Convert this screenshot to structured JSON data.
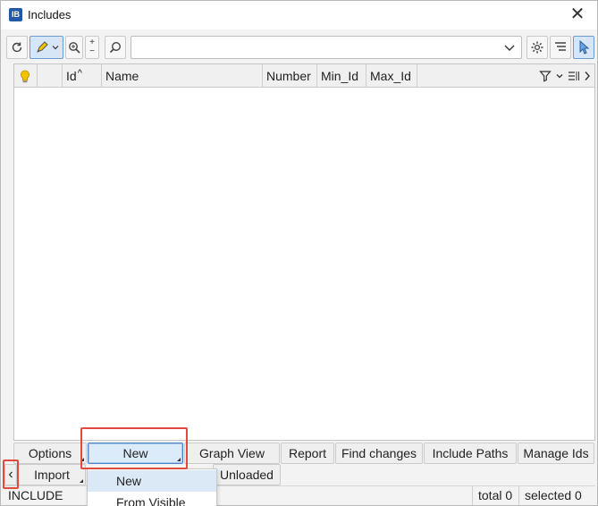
{
  "window": {
    "title": "Includes",
    "app_icon_text": "IB"
  },
  "toolbar": {
    "search_value": "",
    "zoom_plus": "+",
    "zoom_minus": "−"
  },
  "grid": {
    "columns": [
      {
        "label": ""
      },
      {
        "label": ""
      },
      {
        "label": "Id"
      },
      {
        "label": "Name"
      },
      {
        "label": "Number"
      },
      {
        "label": "Min_Id"
      },
      {
        "label": "Max_Id"
      }
    ],
    "rows": []
  },
  "buttons": {
    "options": "Options",
    "new": "New",
    "graph_view": "Graph View",
    "report": "Report",
    "find_changes": "Find changes",
    "include_paths": "Include Paths",
    "manage_ids": "Manage Ids",
    "import": "Import",
    "unloaded": "Unloaded",
    "scroll_left": "‹"
  },
  "menu": {
    "items": [
      "New",
      "From Visible"
    ]
  },
  "status": {
    "type": "INCLUDE",
    "total": "total 0",
    "selected": "selected 0"
  },
  "colors": {
    "accent": "#4a86c8",
    "highlight": "#e04a3f",
    "bulb": "#f2c200"
  }
}
